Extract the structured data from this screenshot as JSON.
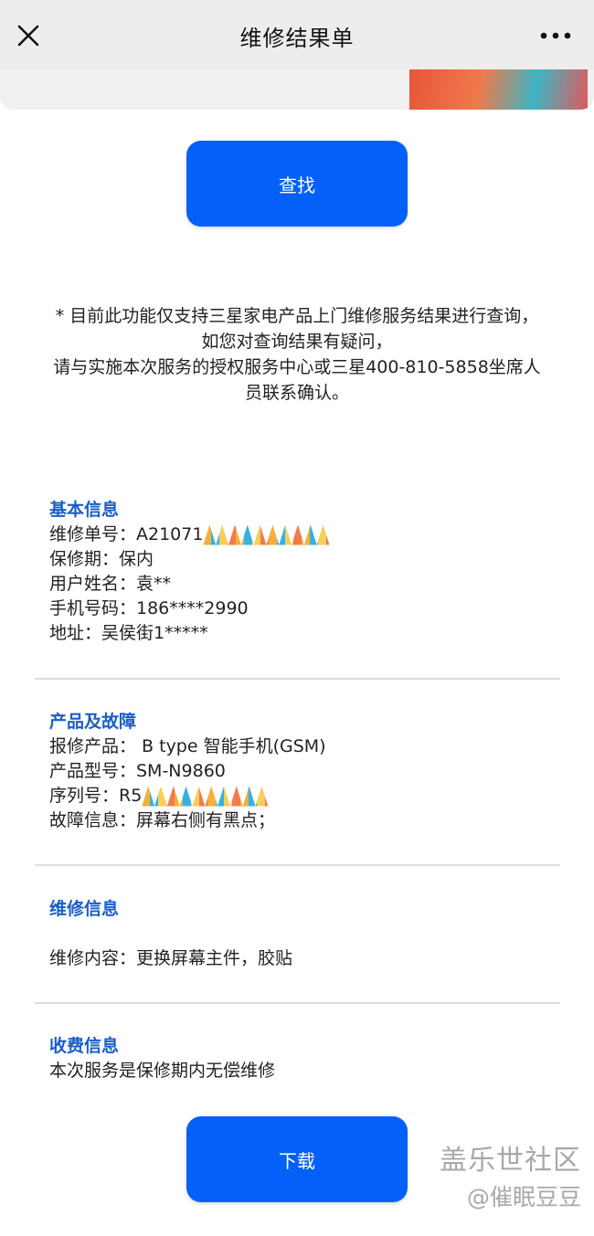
{
  "nav": {
    "title": "维修结果单",
    "close_icon": "close-icon",
    "more_icon": "more-dots-icon"
  },
  "buttons": {
    "search": "查找",
    "download": "下载"
  },
  "notice": {
    "line1": "* 目前此功能仅支持三星家电产品上门维修服务结果进行查询，",
    "line2": "如您对查询结果有疑问，",
    "line3": "请与实施本次服务的授权服务中心或三星400-810-5858坐席人",
    "line4": "员联系确认。"
  },
  "basic": {
    "title": "基本信息",
    "order_no": "维修单号：A21071",
    "warranty": "保修期：保内",
    "user_name": "用户姓名：袁**",
    "phone": "手机号码：186****2990",
    "address": "地址：吴侯街1*****"
  },
  "product": {
    "title": "产品及故障",
    "product_name": "报修产品： B type 智能手机(GSM)",
    "model": "产品型号：SM-N9860",
    "serial": "序列号：R5",
    "fault": "故障信息：屏幕右侧有黑点；"
  },
  "repair": {
    "title": "维修信息",
    "content": "维修内容：更换屏幕主件，胶贴"
  },
  "fee": {
    "title": "收费信息",
    "content": "本次服务是保修期内无偿维修"
  },
  "watermark": {
    "line1": "盖乐世社区",
    "line2": "@催眠豆豆"
  },
  "colors": {
    "accent": "#0460f8",
    "section_title": "#1a5fc9",
    "nav_bg": "#ededed"
  }
}
